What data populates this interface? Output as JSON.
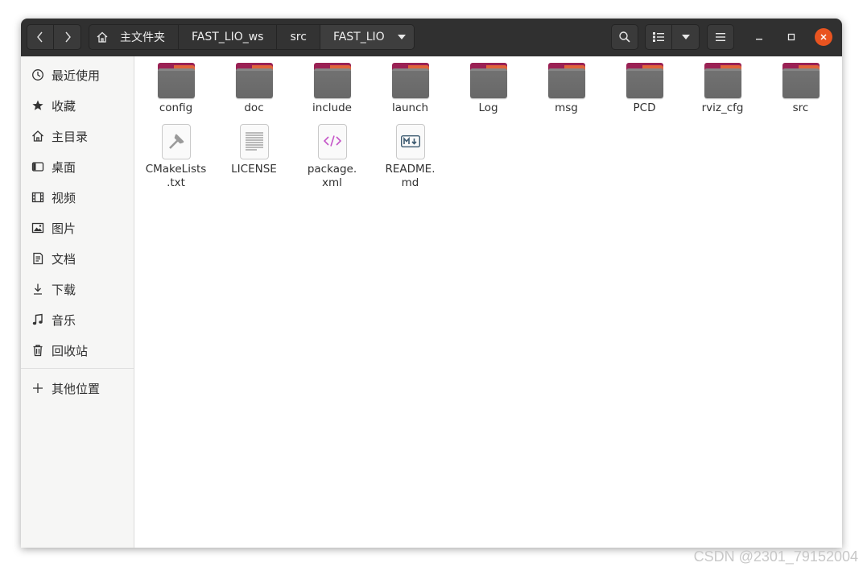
{
  "header": {
    "breadcrumbs": [
      "主文件夹",
      "FAST_LIO_ws",
      "src",
      "FAST_LIO"
    ]
  },
  "sidebar": {
    "items": [
      {
        "label": "最近使用",
        "icon": "clock-icon"
      },
      {
        "label": "收藏",
        "icon": "star-icon"
      },
      {
        "label": "主目录",
        "icon": "home-icon"
      },
      {
        "label": "桌面",
        "icon": "desktop-icon"
      },
      {
        "label": "视频",
        "icon": "video-icon"
      },
      {
        "label": "图片",
        "icon": "picture-icon"
      },
      {
        "label": "文档",
        "icon": "document-icon"
      },
      {
        "label": "下载",
        "icon": "download-icon"
      },
      {
        "label": "音乐",
        "icon": "music-icon"
      },
      {
        "label": "回收站",
        "icon": "trash-icon"
      }
    ],
    "other": {
      "label": "其他位置",
      "icon": "plus-icon"
    }
  },
  "files": {
    "folders": [
      "config",
      "doc",
      "include",
      "launch",
      "Log",
      "msg",
      "PCD",
      "rviz_cfg",
      "src"
    ],
    "documents": [
      {
        "name": "CMakeLists\n.txt",
        "icon": "cmake-file-icon"
      },
      {
        "name": "LICENSE",
        "icon": "text-file-icon"
      },
      {
        "name": "package.\nxml",
        "icon": "xml-file-icon"
      },
      {
        "name": "README.\nmd",
        "icon": "markdown-file-icon"
      }
    ]
  },
  "colors": {
    "headerbar": "#303030",
    "accent_close": "#e95420",
    "folder_tab": "#9a2154",
    "folder_body": "#6e6e6e"
  },
  "watermark": "CSDN @2301_79152004"
}
